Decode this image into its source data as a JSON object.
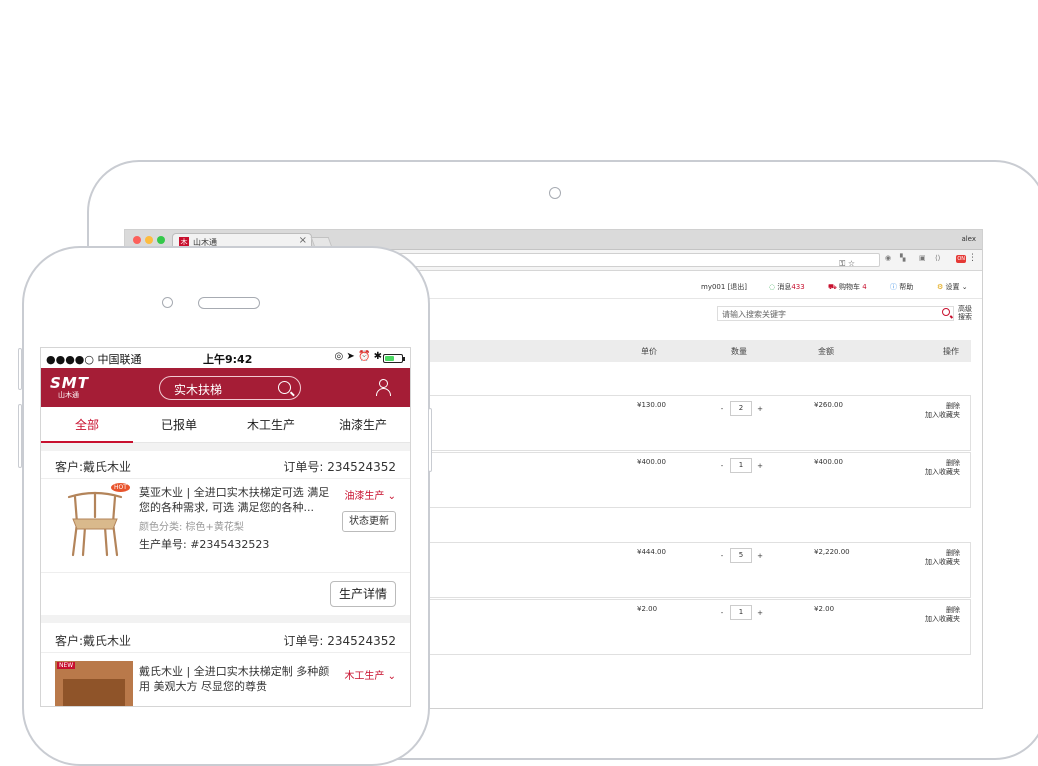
{
  "browser": {
    "tab_title": "山木通",
    "tab_close": "×",
    "tab_favicon": "木",
    "profile_name": "alex",
    "menu": "⋮",
    "ext_badge": "ON"
  },
  "desktop_site": {
    "top_nav": {
      "user": "my001",
      "logout": "[退出]",
      "messages_label": "消息",
      "messages_count": "433",
      "cart_label": "购物车",
      "cart_count": "4",
      "help": "帮助",
      "settings": "设置"
    },
    "search": {
      "placeholder": "请输入搜索关键字",
      "advanced": "高级搜索"
    },
    "table_headers": {
      "unit_price": "单价",
      "quantity": "数量",
      "amount": "金额",
      "actions": "操作"
    },
    "rows": [
      {
        "price": "¥130.00",
        "qty": "2",
        "amount": "¥260.00",
        "op1": "删除",
        "op2": "加入收藏夹"
      },
      {
        "price": "¥400.00",
        "qty": "1",
        "amount": "¥400.00",
        "op1": "删除",
        "op2": "加入收藏夹"
      },
      {
        "price": "¥444.00",
        "qty": "5",
        "amount": "¥2,220.00",
        "op1": "删除",
        "op2": "加入收藏夹"
      },
      {
        "price": "¥2.00",
        "qty": "1",
        "amount": "¥2.00",
        "op1": "删除",
        "op2": "加入收藏夹"
      }
    ],
    "qty_minus": "-",
    "qty_plus": "+"
  },
  "phone": {
    "status": {
      "carrier": "●●●●○ 中国联通",
      "time": "上午9:42",
      "icons": "◎ ➤ ⏰ ✱",
      "battery_level": 0.55
    },
    "app": {
      "logo_main": "SMT",
      "logo_sub": "山木通",
      "search_text": "实木扶梯"
    },
    "tabs": [
      {
        "label": "全部",
        "active": true
      },
      {
        "label": "已报单",
        "active": false
      },
      {
        "label": "木工生产",
        "active": false
      },
      {
        "label": "油漆生产",
        "active": false
      }
    ],
    "orders": [
      {
        "customer": "客户:戴氏木业",
        "order_no": "订单号: 234524352",
        "title": "莫亚木业 | 全进口实木扶梯定可选 满足您的各种需求, 可选 满足您的各种...",
        "attributes": "颜色分类: 棕色+黄花梨",
        "production_no": "生产单号: #2345432523",
        "status": "油漆生产",
        "status_button": "状态更新",
        "detail_button": "生产详情",
        "img_badge": "HOT"
      },
      {
        "customer": "客户:戴氏木业",
        "order_no": "订单号: 234524352",
        "title": "戴氏木业 | 全进口实木扶梯定制 多种颜用 美观大方 尽显您的尊贵",
        "status": "木工生产",
        "img_badge": "NEW"
      }
    ]
  }
}
